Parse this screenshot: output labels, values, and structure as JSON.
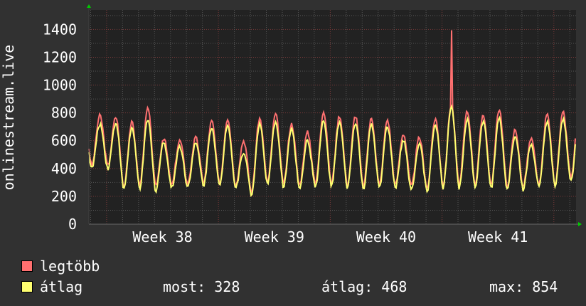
{
  "colors": {
    "max": "#ff7070",
    "avg": "#ffff70",
    "bg": "#313131",
    "plot_bg": "#222222",
    "axis_arrow": "#00cc00"
  },
  "chart_data": {
    "type": "line",
    "ylabel": "onlinestream.live",
    "ylim": [
      0,
      1540
    ],
    "yticks": [
      0,
      200,
      400,
      600,
      800,
      1000,
      1200,
      1400
    ],
    "xlim_days": [
      0,
      30.5
    ],
    "xticks": [
      {
        "label": "Week 38",
        "start_day": 1.11
      },
      {
        "label": "Week 39",
        "start_day": 8.11
      },
      {
        "label": "Week 40",
        "start_day": 15.11
      },
      {
        "label": "Week 41",
        "start_day": 22.11
      }
    ],
    "first_peak_day": 1.69,
    "series": [
      {
        "name": "legtöbb",
        "key": "max",
        "peaks": [
          780,
          770,
          730,
          830,
          620,
          600,
          620,
          740,
          760,
          600,
          760,
          790,
          720,
          660,
          810,
          780,
          780,
          760,
          750,
          650,
          620,
          760,
          1400,
          810,
          790,
          830,
          680,
          610,
          790,
          800
        ],
        "troughs": [
          420,
          270,
          280,
          270,
          280,
          290,
          300,
          290,
          280,
          230,
          300,
          290,
          280,
          290,
          290,
          280,
          270,
          280,
          280,
          270,
          260,
          280,
          280,
          290,
          280,
          270,
          270,
          280,
          290,
          330
        ]
      },
      {
        "name": "átlag",
        "key": "avg",
        "peaks": [
          720,
          730,
          690,
          750,
          590,
          560,
          580,
          700,
          720,
          520,
          720,
          740,
          680,
          600,
          740,
          730,
          730,
          710,
          700,
          600,
          570,
          720,
          850,
          760,
          740,
          760,
          640,
          570,
          740,
          750
        ],
        "troughs": [
          400,
          250,
          260,
          240,
          260,
          270,
          280,
          270,
          260,
          210,
          280,
          270,
          260,
          270,
          270,
          260,
          250,
          260,
          260,
          250,
          240,
          260,
          260,
          270,
          260,
          250,
          250,
          260,
          270,
          310
        ]
      }
    ]
  },
  "legend": {
    "max_label": "legtöbb",
    "avg_label": "átlag",
    "stats": {
      "now": "most: 328",
      "avg": "átlag: 468",
      "max": "max: 854"
    }
  }
}
